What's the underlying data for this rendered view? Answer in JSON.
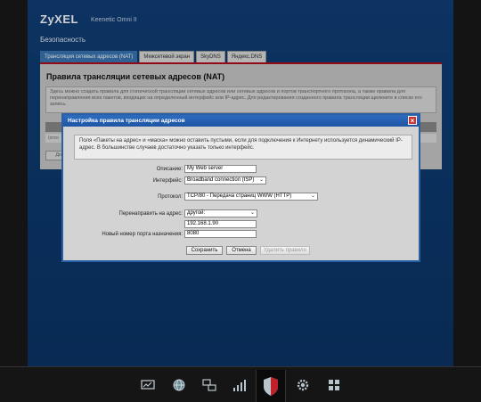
{
  "app": {
    "brand": "ZyXEL",
    "model": "Keenetic Omni II",
    "section": "Безопасность"
  },
  "tabs": [
    {
      "label": "Трансляция сетевых адресов (NAT)",
      "active": true
    },
    {
      "label": "Межсетевой экран",
      "active": false
    },
    {
      "label": "SkyDNS",
      "active": false
    },
    {
      "label": "Яндекс.DNS",
      "active": false
    }
  ],
  "content": {
    "heading": "Правила трансляции сетевых адресов (NAT)",
    "info": "Здесь можно создать правила для статической трансляции сетевых адресов или сетевых адресов и портов транспортного протокола, а также правила для перенаправления всех пакетов, входящих на определенный интерфейс или IP-адрес. Для редактирования созданного правила трансляции щелкните в списке его запись.",
    "row_stub": "(отсо",
    "button_stub": "Доб"
  },
  "dialog": {
    "title": "Настройка правила трансляции адресов",
    "close_glyph": "×",
    "note": "Поля «Пакеты на адрес» и «маска» можно оставить пустыми, если для подключения к Интернету используется динамический IP-адрес. В большинстве случаев достаточно указать только интерфейс.",
    "fields": {
      "description_label": "Описание:",
      "description_value": "My Web server",
      "interface_label": "Интерфейс:",
      "interface_value": "Broadband connection (ISP)",
      "protocol_label": "Протокол:",
      "protocol_value": "TCP/80 - Передача страниц WWW (HTTP)",
      "redirect_label": "Перенаправить на адрес:",
      "redirect_value": "другой:",
      "redirect_ip": "192.168.1.90",
      "port_label": "Новый номер порта назначения:",
      "port_value": "8080"
    },
    "buttons": {
      "save": "Сохранить",
      "cancel": "Отмена",
      "delete": "Удалить правило"
    }
  },
  "colors": {
    "accent": "#2a5fa6",
    "tab_active": "#3a76b5",
    "brand_red": "#b00e1a"
  },
  "dock": {
    "icons": [
      "monitor-icon",
      "globe-icon",
      "network-icon",
      "signal-bars-icon",
      "shield-icon",
      "gear-icon",
      "apps-grid-icon"
    ],
    "active": "shield-icon"
  }
}
